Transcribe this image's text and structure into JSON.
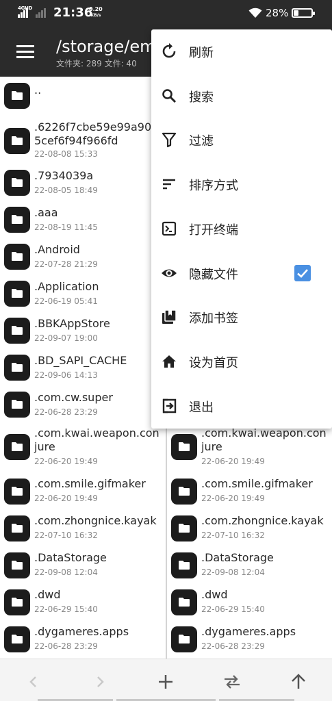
{
  "status_bar": {
    "network": "4GHD",
    "time": "21:36",
    "speed_value": "0.20",
    "speed_unit": "KB/s",
    "battery": "28%",
    "battery_level": 0.28
  },
  "app_bar": {
    "path": "/storage/em",
    "summary": "文件夹: 289  文件: 40"
  },
  "left_list": [
    {
      "name": "..",
      "date": ""
    },
    {
      "name": ".6226f7cbe59e99a90",
      "name2": "5cef6f94f966fd",
      "date": "22-08-08 15:33"
    },
    {
      "name": ".7934039a",
      "date": "22-08-05 18:49"
    },
    {
      "name": ".aaa",
      "date": "22-08-19 11:45"
    },
    {
      "name": ".Android",
      "date": "22-07-28 21:29"
    },
    {
      "name": ".Application",
      "date": "22-06-19 05:41"
    },
    {
      "name": ".BBKAppStore",
      "date": "22-09-07 19:00"
    },
    {
      "name": ".BD_SAPI_CACHE",
      "date": "22-09-06 14:13"
    },
    {
      "name": ".com.cw.super",
      "date": "22-06-28 23:29"
    },
    {
      "name": ".com.kwai.weapon.con",
      "name2": "jure",
      "date": "22-06-20 19:49"
    },
    {
      "name": ".com.smile.gifmaker",
      "date": "22-06-20 19:49"
    },
    {
      "name": ".com.zhongnice.kayak",
      "date": "22-07-10 16:32"
    },
    {
      "name": ".DataStorage",
      "date": "22-09-08 12:04"
    },
    {
      "name": ".dwd",
      "date": "22-06-29 15:40"
    },
    {
      "name": ".dygameres.apps",
      "date": "22-06-28 23:29"
    }
  ],
  "right_list": [
    {
      "name": ".com.kwai.weapon.con",
      "name2": "jure",
      "date": "22-06-20 19:49"
    },
    {
      "name": ".com.smile.gifmaker",
      "date": "22-06-20 19:49"
    },
    {
      "name": ".com.zhongnice.kayak",
      "date": "22-07-10 16:32"
    },
    {
      "name": ".DataStorage",
      "date": "22-09-08 12:04"
    },
    {
      "name": ".dwd",
      "date": "22-06-29 15:40"
    },
    {
      "name": ".dygameres.apps",
      "date": "22-06-28 23:29"
    }
  ],
  "menu": {
    "items": [
      {
        "label": "刷新",
        "icon": "refresh-icon"
      },
      {
        "label": "搜索",
        "icon": "search-icon"
      },
      {
        "label": "过滤",
        "icon": "filter-icon"
      },
      {
        "label": "排序方式",
        "icon": "sort-icon"
      },
      {
        "label": "打开终端",
        "icon": "terminal-icon"
      },
      {
        "label": "隐藏文件",
        "icon": "eye-icon",
        "checked": true
      },
      {
        "label": "添加书签",
        "icon": "bookmark-add-icon"
      },
      {
        "label": "设为首页",
        "icon": "home-icon"
      },
      {
        "label": "退出",
        "icon": "exit-icon"
      }
    ]
  },
  "bottom_bar": {
    "buttons": [
      "back-icon",
      "forward-icon",
      "add-icon",
      "swap-icon",
      "up-icon"
    ]
  },
  "colors": {
    "bar": "#2b2b2b",
    "accent": "#4a90e2",
    "folder": "#1c1c1c"
  }
}
